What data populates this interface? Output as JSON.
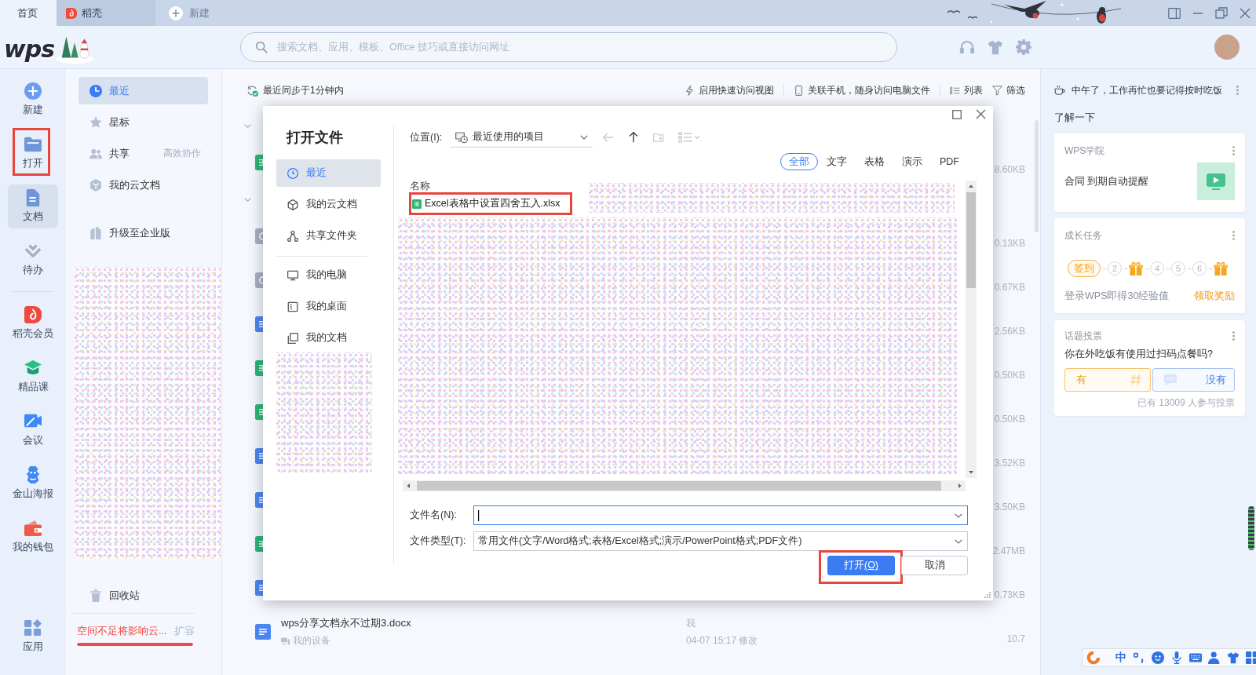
{
  "tab_bar": {
    "tabs": [
      {
        "kind": "home",
        "label": "首页",
        "selected": true
      },
      {
        "kind": "docer",
        "label": "稻壳",
        "selected": false
      }
    ],
    "new_tab": "新建"
  },
  "header": {
    "logo": "wps",
    "search": {
      "placeholder": "搜索文档、应用、模板、Office 技巧或直接访问网址"
    }
  },
  "nav_rail": {
    "items": [
      {
        "kind": "new",
        "label": "新建",
        "selected": false,
        "highlighted": false
      },
      {
        "kind": "open",
        "label": "打开",
        "selected": false,
        "highlighted": true
      },
      {
        "kind": "docs",
        "label": "文档",
        "selected": true,
        "highlighted": false
      },
      {
        "kind": "todo",
        "label": "待办",
        "selected": false,
        "highlighted": false
      }
    ],
    "services": [
      {
        "kind": "docer",
        "label": "稻壳会员",
        "selected": false
      },
      {
        "kind": "course",
        "label": "精品课",
        "selected": false
      },
      {
        "kind": "meeting",
        "label": "会议",
        "selected": false
      },
      {
        "kind": "poster",
        "label": "金山海报",
        "selected": false
      },
      {
        "kind": "wallet",
        "label": "我的钱包",
        "selected": false
      }
    ],
    "bottom_item": {
      "kind": "apps",
      "label": "应用",
      "selected": false
    }
  },
  "sidebar": {
    "items": [
      {
        "kind": "recent",
        "label": "最近",
        "selected": true
      },
      {
        "kind": "star",
        "label": "星标",
        "selected": false
      },
      {
        "kind": "share",
        "label": "共享",
        "note": "高效协作",
        "selected": false
      },
      {
        "kind": "cloud",
        "label": "我的云文档",
        "selected": false
      }
    ],
    "upgrade": "升级至企业版",
    "trash": "回收站",
    "storage": {
      "warning": "空间不足将影响云...",
      "action": "扩容",
      "level": 1
    }
  },
  "main": {
    "sync_status": "最近同步于1分钟内",
    "toolbar": [
      {
        "kind": "quick",
        "label": "启用快速访问视图"
      },
      {
        "kind": "phone",
        "label": "关联手机，随身访问电脑文件"
      },
      {
        "kind": "list",
        "label": "列表"
      },
      {
        "kind": "filter",
        "label": "筛选"
      }
    ],
    "rows": [
      {
        "kind": "group",
        "expanded": true
      },
      {
        "kind": "sheet",
        "size": "8.60KB"
      },
      {
        "kind": "group",
        "expanded": true
      },
      {
        "kind": "other",
        "size": "0.13KB"
      },
      {
        "kind": "other",
        "size": "0.67KB"
      },
      {
        "kind": "doc",
        "size": "2.56KB"
      },
      {
        "kind": "sheet",
        "size": "0.50KB"
      },
      {
        "kind": "sheet",
        "size": "0.50KB"
      },
      {
        "kind": "doc",
        "size": "3.52KB"
      },
      {
        "kind": "doc",
        "size": "3.50KB"
      },
      {
        "kind": "sheet",
        "size": "2.47MB"
      },
      {
        "kind": "doc",
        "size": "0.73KB"
      },
      {
        "kind": "doc",
        "name": "wps分享文档永不过期3.docx",
        "location": "我的设备",
        "owner": "我",
        "modified": "04-07 15:17 修改",
        "size": "10.7"
      }
    ]
  },
  "dialog": {
    "title": "打开文件",
    "nav": [
      {
        "kind": "recent",
        "label": "最近",
        "selected": true
      },
      {
        "kind": "cloud",
        "label": "我的云文档",
        "selected": false
      },
      {
        "kind": "shared",
        "label": "共享文件夹",
        "selected": false
      }
    ],
    "places": [
      {
        "kind": "pc",
        "label": "我的电脑",
        "selected": false
      },
      {
        "kind": "desktop",
        "label": "我的桌面",
        "selected": false
      },
      {
        "kind": "documents",
        "label": "我的文档",
        "selected": false
      }
    ],
    "location": {
      "label": "位置(I):",
      "value": "最近使用的项目"
    },
    "nav_buttons": [
      {
        "kind": "back",
        "disabled": true
      },
      {
        "kind": "up",
        "disabled": false
      },
      {
        "kind": "new_folder",
        "disabled": true
      },
      {
        "kind": "view",
        "disabled": true
      }
    ],
    "filters": [
      {
        "label": "全部",
        "selected": true
      },
      {
        "label": "文字",
        "selected": false
      },
      {
        "label": "表格",
        "selected": false
      },
      {
        "label": "演示",
        "selected": false
      },
      {
        "label": "PDF",
        "selected": false
      }
    ],
    "list": {
      "column": "名称",
      "items": [
        {
          "kind": "sheet",
          "name": "Excel表格中设置四舍五入.xlsx",
          "highlighted": true
        }
      ]
    },
    "file_name": {
      "label": "文件名(N):",
      "focused": true
    },
    "file_type": {
      "label": "文件类型(T):",
      "value": "常用文件(文字/Word格式;表格/Excel格式;演示/PowerPoint格式;PDF文件)"
    },
    "buttons": [
      {
        "kind": "primary",
        "label": "打开",
        "access_key": "(O)",
        "highlighted": true
      },
      {
        "kind": "secondary",
        "label": "取消",
        "highlighted": false
      }
    ]
  },
  "right_panel": {
    "greeting": "中午了，工作再忙也要记得按时吃饭",
    "section_title": "了解一下",
    "academy": {
      "title": "WPS学院",
      "text": "合同 到期自动提醒"
    },
    "tasks": {
      "title": "成长任务",
      "steps": [
        {
          "kind": "label",
          "label": "签到"
        },
        {
          "kind": "number",
          "label": "2"
        },
        {
          "kind": "gift"
        },
        {
          "kind": "number",
          "label": "4"
        },
        {
          "kind": "number",
          "label": "5"
        },
        {
          "kind": "number",
          "label": "6"
        },
        {
          "kind": "gift"
        }
      ],
      "text": "登录WPS即得30经验值",
      "action": "领取奖励"
    },
    "poll": {
      "title": "话题投票",
      "question": "你在外吃饭有使用过扫码点餐吗?",
      "options": [
        {
          "kind": "yes",
          "label": "有"
        },
        {
          "kind": "no",
          "label": "没有"
        }
      ],
      "footer": "已有 13009 人参与投票"
    }
  },
  "ime_bar": {
    "mode": "中"
  }
}
